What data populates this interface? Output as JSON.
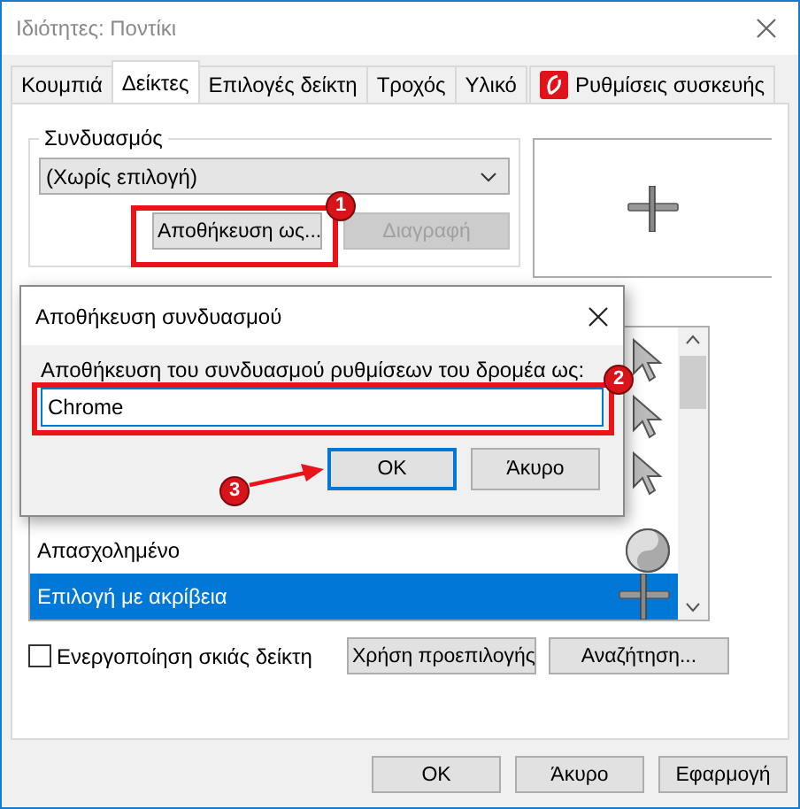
{
  "window": {
    "title": "Ιδιότητες: Ποντίκι"
  },
  "tabs": [
    {
      "label": "Κουμπιά",
      "selected": false,
      "kind": "text"
    },
    {
      "label": "Δείκτες",
      "selected": true,
      "kind": "text"
    },
    {
      "label": "Επιλογές δείκτη",
      "selected": false,
      "kind": "text"
    },
    {
      "label": "Τροχός",
      "selected": false,
      "kind": "text"
    },
    {
      "label": "Υλικό",
      "selected": false,
      "kind": "text"
    },
    {
      "label": "Ρυθμίσεις συσκευής",
      "selected": false,
      "kind": "device"
    }
  ],
  "scheme": {
    "label": "Συνδυασμός",
    "value": "(Χωρίς επιλογή)",
    "buttons": [
      {
        "label": "Αποθήκευση ως...",
        "disabled": false
      },
      {
        "label": "Διαγραφή",
        "disabled": true
      }
    ]
  },
  "cursors": [
    {
      "name": "Απασχολημένο",
      "selected": false,
      "kind": "busy"
    },
    {
      "name": "Επιλογή με ακρίβεια",
      "selected": true,
      "kind": "precision"
    }
  ],
  "shadow_checkbox": {
    "label": "Ενεργοποίηση σκιάς δείκτη",
    "checked": false
  },
  "list_buttons": [
    "Χρήση προεπιλογής",
    "Αναζήτηση..."
  ],
  "footer_buttons": [
    "OK",
    "Άκυρο",
    "Εφαρμογή"
  ],
  "dialog": {
    "title": "Αποθήκευση συνδυασμού",
    "prompt": "Αποθήκευση του συνδυασμού ρυθμίσεων του δρομέα ως:",
    "value": "Chrome",
    "buttons": [
      {
        "label": "OK",
        "focused": true
      },
      {
        "label": "Άκυρο",
        "focused": false
      }
    ]
  },
  "annotations": [
    {
      "label": "1"
    },
    {
      "label": "2"
    },
    {
      "label": "3"
    }
  ]
}
